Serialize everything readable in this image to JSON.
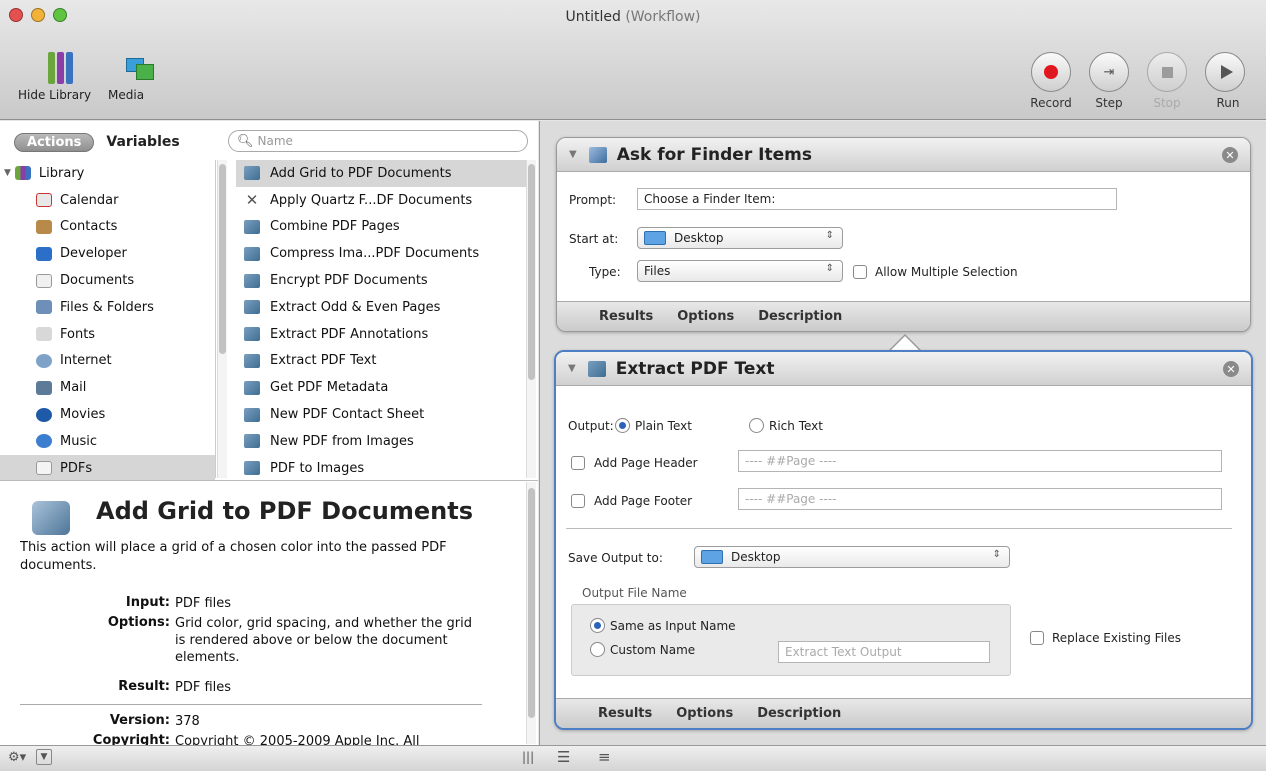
{
  "window": {
    "title": "Untitled",
    "subtitle": "(Workflow)"
  },
  "toolbar": {
    "hide_library": "Hide Library",
    "media": "Media",
    "record": "Record",
    "step": "Step",
    "stop": "Stop",
    "run": "Run"
  },
  "library": {
    "tabs": [
      "Actions",
      "Variables"
    ],
    "search_placeholder": "Name",
    "items": [
      "Library",
      "Calendar",
      "Contacts",
      "Developer",
      "Documents",
      "Files & Folders",
      "Fonts",
      "Internet",
      "Mail",
      "Movies",
      "Music",
      "PDFs"
    ],
    "selected": "PDFs"
  },
  "actions": {
    "items": [
      "Add Grid to PDF Documents",
      "Apply Quartz F...DF Documents",
      "Combine PDF Pages",
      "Compress Ima...PDF Documents",
      "Encrypt PDF Documents",
      "Extract Odd & Even Pages",
      "Extract PDF Annotations",
      "Extract PDF Text",
      "Get PDF Metadata",
      "New PDF Contact Sheet",
      "New PDF from Images",
      "PDF to Images"
    ],
    "selected": "Add Grid to PDF Documents"
  },
  "description": {
    "title": "Add Grid to PDF Documents",
    "text": "This action will place a grid of a chosen color into the passed PDF documents.",
    "input_label": "Input:",
    "input": "PDF files",
    "options_label": "Options:",
    "options": "Grid color, grid spacing, and whether the grid is rendered above or below the document elements.",
    "result_label": "Result:",
    "result": "PDF files",
    "version_label": "Version:",
    "version": "378",
    "copyright_label": "Copyright:",
    "copyright": "Copyright © 2005-2009 Apple Inc.  All"
  },
  "ask_card": {
    "title": "Ask for Finder Items",
    "prompt_label": "Prompt:",
    "prompt_value": "Choose a Finder Item:",
    "start_label": "Start at:",
    "start_value": "Desktop",
    "type_label": "Type:",
    "type_value": "Files",
    "allow_multiple": "Allow Multiple Selection",
    "footer": [
      "Results",
      "Options",
      "Description"
    ]
  },
  "extract_card": {
    "title": "Extract PDF Text",
    "output_label": "Output:",
    "plain_text": "Plain Text",
    "rich_text": "Rich Text",
    "header_label": "Add Page Header",
    "header_value": "---- ##Page ----",
    "footer_label": "Add Page Footer",
    "footer_value": "---- ##Page ----",
    "save_label": "Save Output to:",
    "save_value": "Desktop",
    "file_name_group": "Output File Name",
    "same_as_input": "Same as Input Name",
    "custom_name": "Custom Name",
    "custom_placeholder": "Extract Text Output",
    "replace_existing": "Replace Existing Files",
    "footer": [
      "Results",
      "Options",
      "Description"
    ]
  },
  "colors": {
    "selection_border": "#4d7fc4",
    "record_red": "#e0171e"
  }
}
